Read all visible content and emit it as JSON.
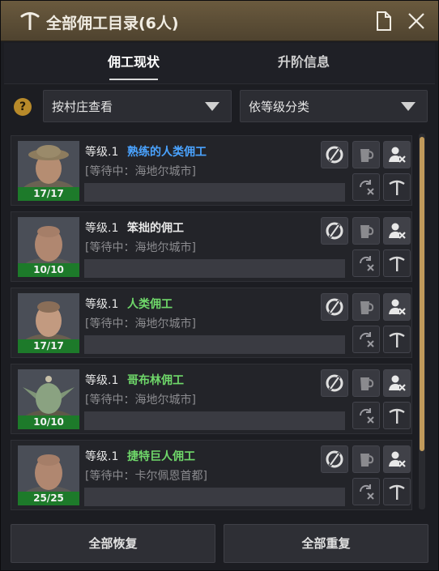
{
  "window": {
    "title": "全部佣工目录(6人)",
    "icons": [
      "pickaxe-icon",
      "document-icon",
      "close-icon"
    ]
  },
  "tabs": [
    {
      "label": "佣工现状",
      "active": true
    },
    {
      "label": "升阶信息",
      "active": false
    }
  ],
  "filters": {
    "help": "?",
    "village_dropdown": "按村庄查看",
    "grade_dropdown": "依等级分类"
  },
  "workers": [
    {
      "grade": "等级.1",
      "name": "熟练的人类佣工",
      "name_color": "#4aa3ff",
      "status": "[等待中：海地尔城市]",
      "stamina": "17/17"
    },
    {
      "grade": "等级.1",
      "name": "笨拙的佣工",
      "name_color": "#e8e8e8",
      "status": "[等待中：海地尔城市]",
      "stamina": "10/10"
    },
    {
      "grade": "等级.1",
      "name": "人类佣工",
      "name_color": "#6fd86a",
      "status": "[等待中：海地尔城市]",
      "stamina": "17/17"
    },
    {
      "grade": "等级.1",
      "name": "哥布林佣工",
      "name_color": "#6fd86a",
      "status": "[等待中：海地尔城市]",
      "stamina": "10/10"
    },
    {
      "grade": "等级.1",
      "name": "捷特巨人佣工",
      "name_color": "#6fd86a",
      "status": "[等待中：卡尔佩恩首都]",
      "stamina": "25/25"
    }
  ],
  "worker_actions": [
    "sleep-icon",
    "cup-icon",
    "fire-worker-icon",
    "swap-icon",
    "pickaxe-icon"
  ],
  "footer": {
    "recover_all": "全部恢复",
    "repeat_all": "全部重复"
  },
  "colors": {
    "titlebar": "#5c4e36",
    "stamina": "#1d7a2a",
    "scroll_thumb": "#c19a5b"
  }
}
